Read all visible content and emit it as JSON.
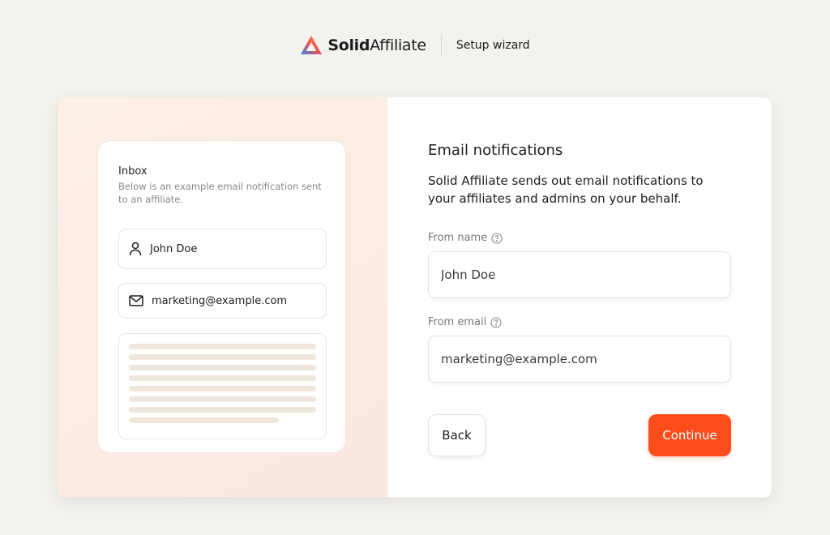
{
  "header": {
    "brand_bold": "Solid",
    "brand_light": "Affiliate",
    "wizard_label": "Setup wizard"
  },
  "preview": {
    "title": "Inbox",
    "subtitle": "Below is an example email notification sent to an affiliate.",
    "from_name": "John Doe",
    "from_email": "marketing@example.com",
    "icons": {
      "name": "user-icon",
      "email": "mail-icon"
    }
  },
  "form": {
    "title": "Email notifications",
    "description": "Solid Affiliate sends out email notifications to your affiliates and admins on your behalf.",
    "from_name_label": "From name",
    "from_name_value": "John Doe",
    "from_email_label": "From email",
    "from_email_value": "marketing@example.com",
    "help_icon": "help-circle-icon"
  },
  "actions": {
    "back_label": "Back",
    "continue_label": "Continue"
  },
  "colors": {
    "accent": "#fb4c1c",
    "background": "#f3f2ee",
    "preview_bg": "#fdf0e7"
  }
}
